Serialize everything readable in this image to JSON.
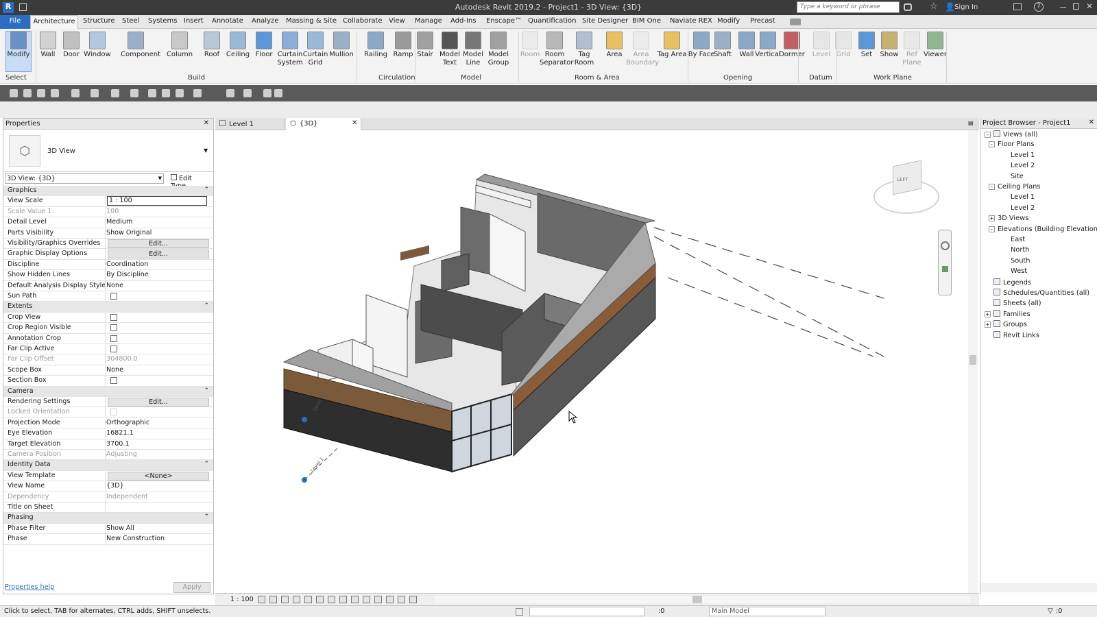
{
  "title_bar": {
    "app_title": "Autodesk Revit 2019.2 - Project1 - 3D View: {3D}",
    "search_placeholder": "Type a keyword or phrase",
    "sign_in": "Sign In"
  },
  "menu_tabs": [
    "File",
    "Architecture",
    "Structure",
    "Steel",
    "Systems",
    "Insert",
    "Annotate",
    "Analyze",
    "Massing & Site",
    "Collaborate",
    "View",
    "Manage",
    "Add-Ins",
    "Enscape™",
    "Quantification",
    "Site Designer",
    "BIM One",
    "Naviate REX",
    "Modify",
    "Precast"
  ],
  "ribbon": {
    "buttons": [
      {
        "label": "Modify",
        "icon": "cursor-icon"
      },
      {
        "label": "Wall",
        "icon": "wall-icon"
      },
      {
        "label": "Door",
        "icon": "door-icon"
      },
      {
        "label": "Window",
        "icon": "window-icon"
      },
      {
        "label": "Component",
        "icon": "component-icon"
      },
      {
        "label": "Column",
        "icon": "column-icon"
      },
      {
        "label": "Roof",
        "icon": "roof-icon"
      },
      {
        "label": "Ceiling",
        "icon": "ceiling-icon"
      },
      {
        "label": "Floor",
        "icon": "floor-icon"
      },
      {
        "label": "Curtain System",
        "icon": "curtain-system-icon"
      },
      {
        "label": "Curtain Grid",
        "icon": "curtain-grid-icon"
      },
      {
        "label": "Mullion",
        "icon": "mullion-icon"
      },
      {
        "label": "Railing",
        "icon": "railing-icon"
      },
      {
        "label": "Ramp",
        "icon": "ramp-icon"
      },
      {
        "label": "Stair",
        "icon": "stair-icon"
      },
      {
        "label": "Model Text",
        "icon": "model-text-icon"
      },
      {
        "label": "Model Line",
        "icon": "model-line-icon"
      },
      {
        "label": "Model Group",
        "icon": "model-group-icon"
      },
      {
        "label": "Room",
        "icon": "room-icon"
      },
      {
        "label": "Room Separator",
        "icon": "room-separator-icon"
      },
      {
        "label": "Tag Room",
        "icon": "tag-room-icon"
      },
      {
        "label": "Area",
        "icon": "area-icon"
      },
      {
        "label": "Area Boundary",
        "icon": "area-boundary-icon"
      },
      {
        "label": "Tag Area",
        "icon": "tag-area-icon"
      },
      {
        "label": "By Face",
        "icon": "by-face-icon"
      },
      {
        "label": "Shaft",
        "icon": "shaft-icon"
      },
      {
        "label": "Wall",
        "icon": "wall-opening-icon"
      },
      {
        "label": "Vertical",
        "icon": "vertical-icon"
      },
      {
        "label": "Dormer",
        "icon": "dormer-icon"
      },
      {
        "label": "Level",
        "icon": "level-icon"
      },
      {
        "label": "Grid",
        "icon": "grid-icon"
      },
      {
        "label": "Set",
        "icon": "set-icon"
      },
      {
        "label": "Show",
        "icon": "show-icon"
      },
      {
        "label": "Ref Plane",
        "icon": "ref-plane-icon"
      },
      {
        "label": "Viewer",
        "icon": "viewer-icon"
      }
    ],
    "groups": [
      "Select",
      "Build",
      "Circulation",
      "Model",
      "Room & Area",
      "Opening",
      "Datum",
      "Work Plane"
    ]
  },
  "properties": {
    "header": "Properties",
    "type_name": "3D View",
    "selector": "3D View: {3D}",
    "edit_type": "Edit Type",
    "rows": [
      {
        "k": "Graphics",
        "s": 1
      },
      {
        "k": "View Scale",
        "v": "1 : 100",
        "box": 1
      },
      {
        "k": "Scale Value    1:",
        "v": "100",
        "d": 1
      },
      {
        "k": "Detail Level",
        "v": "Medium"
      },
      {
        "k": "Parts Visibility",
        "v": "Show Original"
      },
      {
        "k": "Visibility/Graphics Overrides",
        "v": "Edit...",
        "b": 1
      },
      {
        "k": "Graphic Display Options",
        "v": "Edit...",
        "b": 1
      },
      {
        "k": "Discipline",
        "v": "Coordination"
      },
      {
        "k": "Show Hidden Lines",
        "v": "By Discipline"
      },
      {
        "k": "Default Analysis Display Style",
        "v": "None"
      },
      {
        "k": "Sun Path",
        "c": 1
      },
      {
        "k": "Extents",
        "s": 1
      },
      {
        "k": "Crop View",
        "c": 1
      },
      {
        "k": "Crop Region Visible",
        "c": 1
      },
      {
        "k": "Annotation Crop",
        "c": 1
      },
      {
        "k": "Far Clip Active",
        "c": 1
      },
      {
        "k": "Far Clip Offset",
        "v": "304800.0",
        "d": 1
      },
      {
        "k": "Scope Box",
        "v": "None"
      },
      {
        "k": "Section Box",
        "c": 1
      },
      {
        "k": "Camera",
        "s": 1
      },
      {
        "k": "Rendering Settings",
        "v": "Edit...",
        "b": 1
      },
      {
        "k": "Locked Orientation",
        "c": 1,
        "d": 1
      },
      {
        "k": "Projection Mode",
        "v": "Orthographic"
      },
      {
        "k": "Eye Elevation",
        "v": "16821.1"
      },
      {
        "k": "Target Elevation",
        "v": "3700.1"
      },
      {
        "k": "Camera Position",
        "v": "Adjusting",
        "d": 1
      },
      {
        "k": "Identity Data",
        "s": 1
      },
      {
        "k": "View Template",
        "v": "<None>",
        "b": 1
      },
      {
        "k": "View Name",
        "v": "{3D}"
      },
      {
        "k": "Dependency",
        "v": "Independent",
        "d": 1
      },
      {
        "k": "Title on Sheet",
        "v": ""
      },
      {
        "k": "Phasing",
        "s": 1
      },
      {
        "k": "Phase Filter",
        "v": "Show All"
      },
      {
        "k": "Phase",
        "v": "New Construction"
      }
    ],
    "help": "Properties help",
    "apply": "Apply"
  },
  "view_tabs": [
    {
      "label": "Level 1"
    },
    {
      "label": "{3D}"
    }
  ],
  "view_cube": {
    "face": "LEFT"
  },
  "project_browser": {
    "header": "Project Browser - Project1",
    "items": [
      {
        "t": "Views (all)",
        "l": 0,
        "e": "-"
      },
      {
        "t": "Floor Plans",
        "l": 1,
        "e": "-"
      },
      {
        "t": "Level 1",
        "l": 2
      },
      {
        "t": "Level 2",
        "l": 2
      },
      {
        "t": "Site",
        "l": 2
      },
      {
        "t": "Ceiling Plans",
        "l": 1,
        "e": "-"
      },
      {
        "t": "Level 1",
        "l": 2
      },
      {
        "t": "Level 2",
        "l": 2
      },
      {
        "t": "3D Views",
        "l": 1,
        "e": "+"
      },
      {
        "t": "Elevations (Building Elevation)",
        "l": 1,
        "e": "-"
      },
      {
        "t": "East",
        "l": 2
      },
      {
        "t": "North",
        "l": 2
      },
      {
        "t": "South",
        "l": 2
      },
      {
        "t": "West",
        "l": 2
      },
      {
        "t": "Legends",
        "l": 0
      },
      {
        "t": "Schedules/Quantities (all)",
        "l": 0
      },
      {
        "t": "Sheets (all)",
        "l": 0
      },
      {
        "t": "Families",
        "l": 0,
        "e": "+"
      },
      {
        "t": "Groups",
        "l": 0,
        "e": "+"
      },
      {
        "t": "Revit Links",
        "l": 0
      }
    ]
  },
  "view_bar": {
    "scale": "1 : 100"
  },
  "status_bar": {
    "hint": "Click to select, TAB for alternates, CTRL adds, SHIFT unselects.",
    "count": ":0",
    "model": "Main Model",
    "filter": ":0"
  },
  "level_tags": [
    "Level 2",
    "Level 1"
  ],
  "colors": {
    "accent": "#2b6cc4",
    "title_bg": "#3b3b3b",
    "ribbon_bg": "#f3f3f3",
    "wall_dark": "#3a3a3a",
    "wall_mid": "#6f6f6f",
    "brick": "#7b5a3c"
  }
}
